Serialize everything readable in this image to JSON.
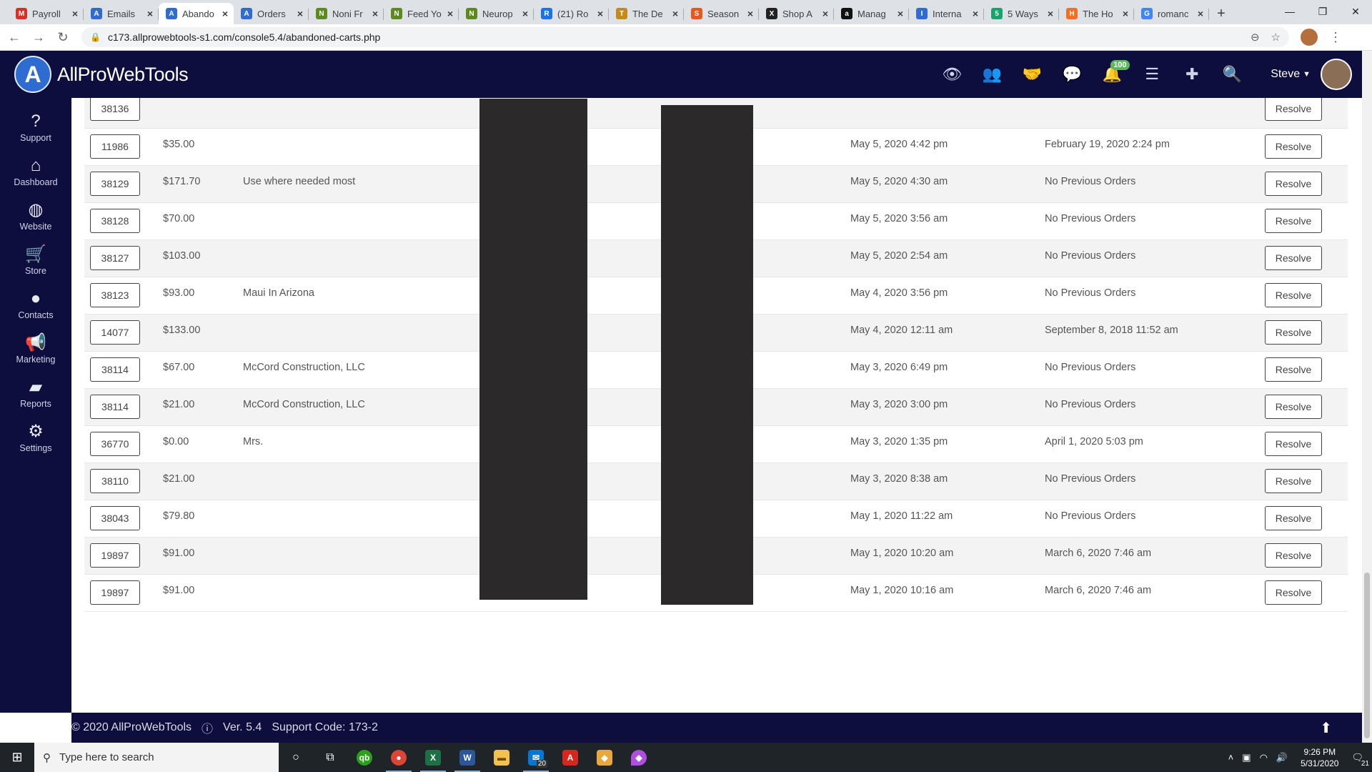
{
  "browser": {
    "tabs": [
      {
        "title": "Payroll",
        "color": "#d93025",
        "glyph": "M"
      },
      {
        "title": "Emails",
        "color": "#2f6cd1",
        "glyph": "A"
      },
      {
        "title": "Abando",
        "color": "#2f6cd1",
        "glyph": "A"
      },
      {
        "title": "Orders",
        "color": "#2f6cd1",
        "glyph": "A"
      },
      {
        "title": "Noni Fr",
        "color": "#5d8a1c",
        "glyph": "N"
      },
      {
        "title": "Feed Yo",
        "color": "#5d8a1c",
        "glyph": "N"
      },
      {
        "title": "Neurop",
        "color": "#5d8a1c",
        "glyph": "N"
      },
      {
        "title": "(21) Ro",
        "color": "#1a73e8",
        "glyph": "R"
      },
      {
        "title": "The De",
        "color": "#c58a1c",
        "glyph": "T"
      },
      {
        "title": "Season",
        "color": "#e8581c",
        "glyph": "S"
      },
      {
        "title": "Shop A",
        "color": "#222222",
        "glyph": "X"
      },
      {
        "title": "Manag",
        "color": "#111111",
        "glyph": "a"
      },
      {
        "title": "Interna",
        "color": "#2f6cd1",
        "glyph": "I"
      },
      {
        "title": "5 Ways",
        "color": "#1aa36a",
        "glyph": "5"
      },
      {
        "title": "The Ho",
        "color": "#f36f21",
        "glyph": "H"
      },
      {
        "title": "romanc",
        "color": "#4285f4",
        "glyph": "G"
      }
    ],
    "url": "c173.allprowebtools-s1.com/console5.4/abandoned-carts.php"
  },
  "header": {
    "brand": "AllProWebTools",
    "logo_letter": "A",
    "notification_count": "100",
    "user_name": "Steve"
  },
  "sidebar": {
    "items": [
      {
        "label": "Support",
        "icon": "?"
      },
      {
        "label": "Dashboard",
        "icon": "⌂"
      },
      {
        "label": "Website",
        "icon": "◍"
      },
      {
        "label": "Store",
        "icon": "🛒"
      },
      {
        "label": "Contacts",
        "icon": "●"
      },
      {
        "label": "Marketing",
        "icon": "📢"
      },
      {
        "label": "Reports",
        "icon": "▰"
      },
      {
        "label": "Settings",
        "icon": "⚙"
      }
    ]
  },
  "table": {
    "resolve_label": "Resolve",
    "rows": [
      {
        "id": "38136",
        "amount": "",
        "name": "",
        "date": "",
        "previous": ""
      },
      {
        "id": "11986",
        "amount": "$35.00",
        "name": "",
        "date": "May 5, 2020 4:42 pm",
        "previous": "February 19, 2020 2:24 pm"
      },
      {
        "id": "38129",
        "amount": "$171.70",
        "name": "Use where needed most",
        "date": "May 5, 2020 4:30 am",
        "previous": "No Previous Orders"
      },
      {
        "id": "38128",
        "amount": "$70.00",
        "name": "",
        "date": "May 5, 2020 3:56 am",
        "previous": "No Previous Orders"
      },
      {
        "id": "38127",
        "amount": "$103.00",
        "name": "",
        "date": "May 5, 2020 2:54 am",
        "previous": "No Previous Orders"
      },
      {
        "id": "38123",
        "amount": "$93.00",
        "name": "Maui In Arizona",
        "date": "May 4, 2020 3:56 pm",
        "previous": "No Previous Orders"
      },
      {
        "id": "14077",
        "amount": "$133.00",
        "name": "",
        "date": "May 4, 2020 12:11 am",
        "previous": "September 8, 2018 11:52 am"
      },
      {
        "id": "38114",
        "amount": "$67.00",
        "name": "McCord Construction, LLC",
        "date": "May 3, 2020 6:49 pm",
        "previous": "No Previous Orders"
      },
      {
        "id": "38114",
        "amount": "$21.00",
        "name": "McCord Construction, LLC",
        "date": "May 3, 2020 3:00 pm",
        "previous": "No Previous Orders"
      },
      {
        "id": "36770",
        "amount": "$0.00",
        "name": "Mrs.",
        "date": "May 3, 2020 1:35 pm",
        "previous": "April 1, 2020 5:03 pm"
      },
      {
        "id": "38110",
        "amount": "$21.00",
        "name": "",
        "date": "May 3, 2020 8:38 am",
        "previous": "No Previous Orders"
      },
      {
        "id": "38043",
        "amount": "$79.80",
        "name": "",
        "date": "May 1, 2020 11:22 am",
        "previous": "No Previous Orders"
      },
      {
        "id": "19897",
        "amount": "$91.00",
        "name": "",
        "date": "May 1, 2020 10:20 am",
        "previous": "March 6, 2020 7:46 am"
      },
      {
        "id": "19897",
        "amount": "$91.00",
        "name": "",
        "date": "May 1, 2020 10:16 am",
        "previous": "March 6, 2020 7:46 am"
      }
    ]
  },
  "footer": {
    "copyright": "© 2020 AllProWebTools",
    "version": "Ver. 5.4",
    "support_code": "Support Code: 173-2"
  },
  "taskbar": {
    "search_placeholder": "Type here to search",
    "mail_count": "20",
    "time": "9:26 PM",
    "date": "5/31/2020",
    "notification_count": "21"
  },
  "colors": {
    "nav_bg": "#0d0d3e",
    "redaction": "#2b2929"
  }
}
